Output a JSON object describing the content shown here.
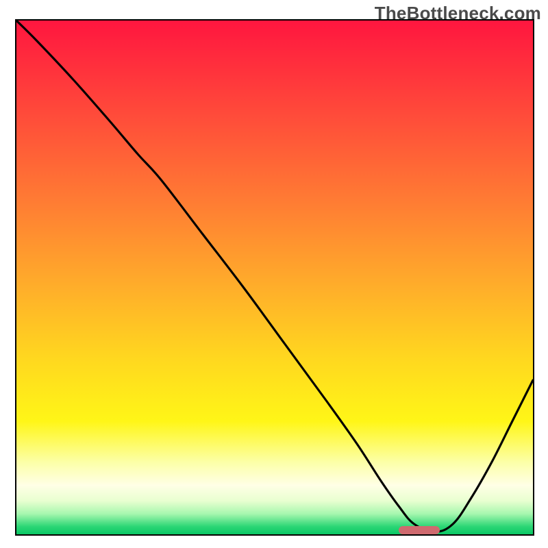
{
  "watermark": "TheBottleneck.com",
  "chart_data": {
    "type": "line",
    "title": "",
    "xlabel": "",
    "ylabel": "",
    "xlim": [
      0,
      100
    ],
    "ylim": [
      0,
      100
    ],
    "axes_visible": false,
    "grid": false,
    "background_gradient_stops": [
      {
        "pos": 0.0,
        "color": "#ff163f"
      },
      {
        "pos": 0.18,
        "color": "#ff4a3a"
      },
      {
        "pos": 0.36,
        "color": "#ff7e33"
      },
      {
        "pos": 0.52,
        "color": "#ffae2a"
      },
      {
        "pos": 0.66,
        "color": "#ffd81f"
      },
      {
        "pos": 0.78,
        "color": "#fff617"
      },
      {
        "pos": 0.86,
        "color": "#fcffa8"
      },
      {
        "pos": 0.905,
        "color": "#ffffe6"
      },
      {
        "pos": 0.935,
        "color": "#e8ffd0"
      },
      {
        "pos": 0.96,
        "color": "#a7f7af"
      },
      {
        "pos": 0.985,
        "color": "#2bd675"
      },
      {
        "pos": 1.0,
        "color": "#09c765"
      }
    ],
    "series": [
      {
        "name": "bottleneck-curve",
        "color": "#000000",
        "x": [
          0.0,
          4.0,
          11.0,
          18.0,
          23.5,
          28.0,
          36.0,
          44.0,
          52.0,
          60.0,
          66.0,
          70.5,
          74.0,
          77.0,
          81.0,
          84.5,
          88.0,
          92.0,
          96.0,
          100.0
        ],
        "y": [
          100.0,
          96.0,
          88.5,
          80.5,
          74.0,
          69.0,
          58.5,
          48.0,
          37.0,
          26.0,
          17.5,
          10.5,
          5.5,
          2.0,
          0.5,
          2.0,
          7.0,
          14.0,
          22.0,
          30.0
        ]
      }
    ],
    "marker": {
      "name": "optimal-range-marker",
      "color": "#cf6a6f",
      "x_start": 74.0,
      "x_end": 82.0,
      "y": 0.8
    }
  }
}
